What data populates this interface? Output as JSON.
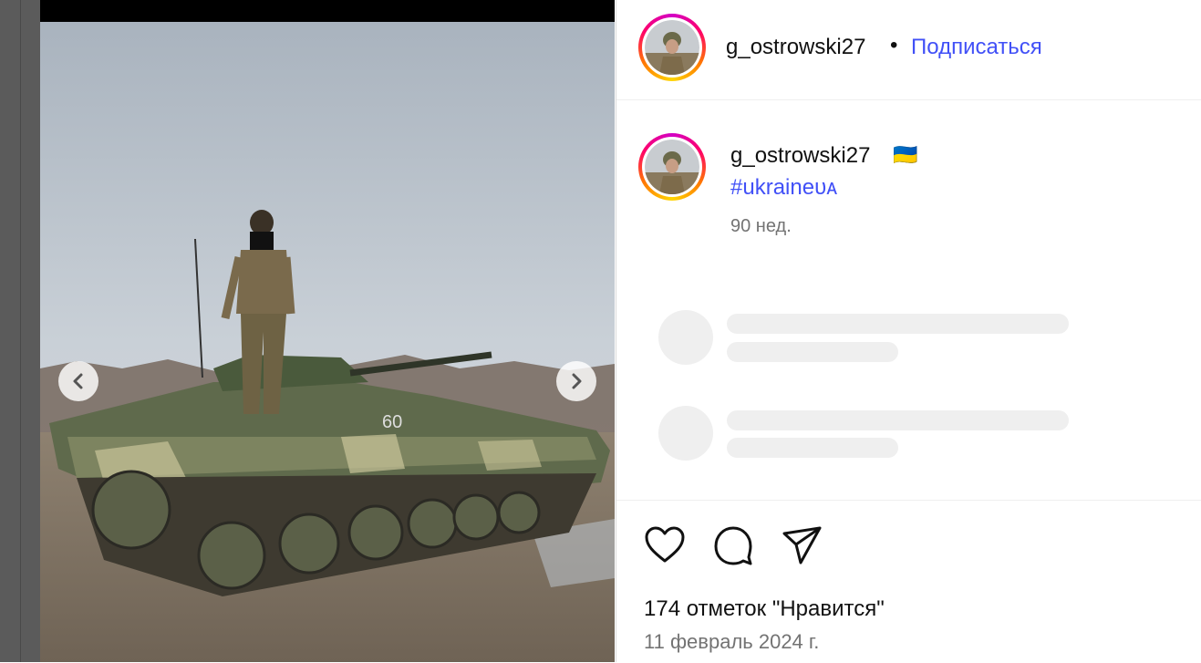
{
  "post": {
    "username": "g_ostrowski27",
    "separator": "•",
    "follow_label": "Подписаться"
  },
  "caption": {
    "username": "g_ostrowski27",
    "flags": "🇺🇦",
    "hashtag": "#ukraineᴜᴀ",
    "time_ago": "90 нед."
  },
  "engagement": {
    "likes_text": "174 отметок \"Нравится\"",
    "date_text": "11 февраль 2024 г."
  },
  "icons": {
    "like": "heart-icon",
    "comment": "comment-bubble-icon",
    "share": "paper-plane-icon",
    "prev": "chevron-left-icon",
    "next": "chevron-right-icon"
  },
  "colors": {
    "link": "#4150f7",
    "muted": "#737373",
    "skeleton": "#efefef"
  }
}
